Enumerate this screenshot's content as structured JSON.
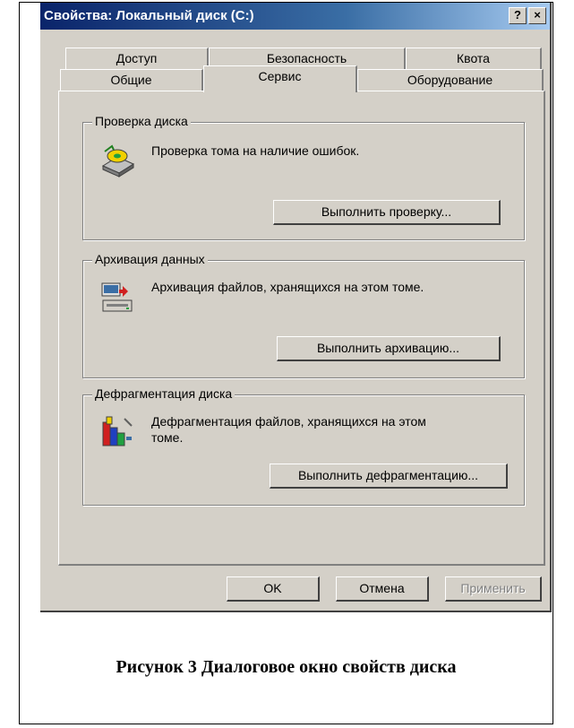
{
  "dialog": {
    "title": "Свойства: Локальный диск (C:)",
    "help_label": "?",
    "close_label": "×"
  },
  "tabs": {
    "row1": [
      "Доступ",
      "Безопасность",
      "Квота"
    ],
    "row2": [
      "Общие",
      "Сервис",
      "Оборудование"
    ],
    "active": "Сервис"
  },
  "groups": {
    "check": {
      "title": "Проверка диска",
      "description": "Проверка тома на наличие ошибок.",
      "button": "Выполнить проверку...",
      "icon": "disk-check-icon"
    },
    "backup": {
      "title": "Архивация данных",
      "description": "Архивация файлов, хранящихся на этом томе.",
      "button": "Выполнить архивацию...",
      "icon": "backup-icon"
    },
    "defrag": {
      "title": "Дефрагментация диска",
      "description_line1": "Дефрагментация файлов, хранящихся на этом",
      "description_line2": "томе.",
      "button": "Выполнить дефрагментацию...",
      "icon": "defrag-icon"
    }
  },
  "footer": {
    "ok": "OK",
    "cancel": "Отмена",
    "apply": "Применить"
  },
  "caption": "Рисунок 3 Диалоговое окно свойств диска"
}
